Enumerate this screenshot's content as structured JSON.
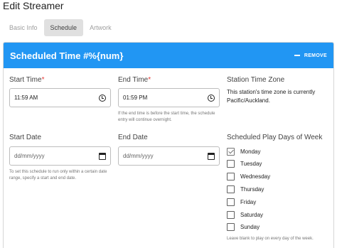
{
  "dialog": {
    "title": "Edit Streamer"
  },
  "tabs": [
    {
      "label": "Basic Info",
      "active": false
    },
    {
      "label": "Schedule",
      "active": true
    },
    {
      "label": "Artwork",
      "active": false
    }
  ],
  "card": {
    "title": "Scheduled Time #%{num}",
    "remove_label": "REMOVE",
    "header_color": "#2196f3"
  },
  "start_time": {
    "label": "Start Time",
    "required_mark": "*",
    "value": "11:59 AM"
  },
  "end_time": {
    "label": "End Time",
    "required_mark": "*",
    "value": "01:59 PM",
    "hint": "If the end time is before the start time, the schedule entry will continue overnight."
  },
  "timezone": {
    "label": "Station Time Zone",
    "text": "This station's time zone is currently Pacific/Auckland."
  },
  "start_date": {
    "label": "Start Date",
    "placeholder": "dd/mm/yyyy",
    "hint": "To set this schedule to run only within a certain date range, specify a start and end date."
  },
  "end_date": {
    "label": "End Date",
    "placeholder": "dd/mm/yyyy"
  },
  "play_days": {
    "label": "Scheduled Play Days of Week",
    "days": [
      {
        "label": "Monday",
        "checked": true
      },
      {
        "label": "Tuesday",
        "checked": false
      },
      {
        "label": "Wednesday",
        "checked": false
      },
      {
        "label": "Thursday",
        "checked": false
      },
      {
        "label": "Friday",
        "checked": false
      },
      {
        "label": "Saturday",
        "checked": false
      },
      {
        "label": "Sunday",
        "checked": false
      }
    ],
    "hint": "Leave blank to play on every day of the week."
  }
}
